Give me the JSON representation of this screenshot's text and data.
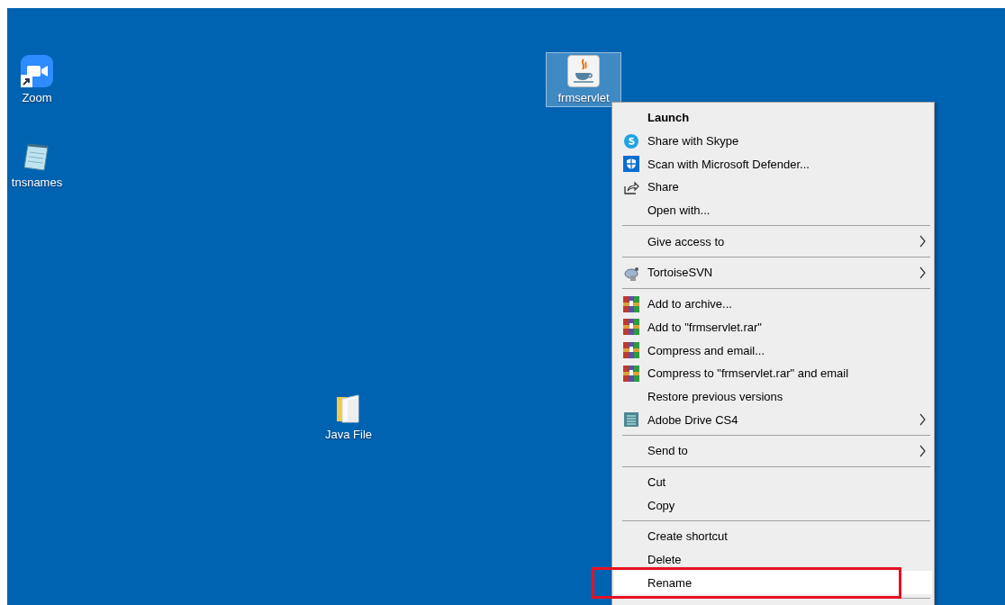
{
  "desktop_icons": [
    {
      "label": "Zoom",
      "kind": "zoom",
      "selected": false
    },
    {
      "label": "tnsnames",
      "kind": "notepad",
      "selected": false
    },
    {
      "label": "frmservlet",
      "kind": "java",
      "selected": true
    },
    {
      "label": "Java File",
      "kind": "folder",
      "selected": false
    }
  ],
  "context_menu": {
    "items": [
      {
        "kind": "item",
        "label": "Launch",
        "default": true,
        "submenu": false,
        "highlighted": false,
        "annotated": false
      },
      {
        "kind": "item",
        "label": "Share with Skype",
        "default": false,
        "submenu": false,
        "highlighted": false,
        "annotated": false
      },
      {
        "kind": "item",
        "label": "Scan with Microsoft Defender...",
        "default": false,
        "submenu": false,
        "highlighted": false,
        "annotated": false
      },
      {
        "kind": "item",
        "label": "Share",
        "default": false,
        "submenu": false,
        "highlighted": false,
        "annotated": false
      },
      {
        "kind": "item",
        "label": "Open with...",
        "default": false,
        "submenu": false,
        "highlighted": false,
        "annotated": false
      },
      {
        "kind": "separator"
      },
      {
        "kind": "item",
        "label": "Give access to",
        "default": false,
        "submenu": true,
        "highlighted": false,
        "annotated": false
      },
      {
        "kind": "separator"
      },
      {
        "kind": "item",
        "label": "TortoiseSVN",
        "default": false,
        "submenu": true,
        "highlighted": false,
        "annotated": false
      },
      {
        "kind": "separator"
      },
      {
        "kind": "item",
        "label": "Add to archive...",
        "default": false,
        "submenu": false,
        "highlighted": false,
        "annotated": false
      },
      {
        "kind": "item",
        "label": "Add to \"frmservlet.rar\"",
        "default": false,
        "submenu": false,
        "highlighted": false,
        "annotated": false
      },
      {
        "kind": "item",
        "label": "Compress and email...",
        "default": false,
        "submenu": false,
        "highlighted": false,
        "annotated": false
      },
      {
        "kind": "item",
        "label": "Compress to \"frmservlet.rar\" and email",
        "default": false,
        "submenu": false,
        "highlighted": false,
        "annotated": false
      },
      {
        "kind": "item",
        "label": "Restore previous versions",
        "default": false,
        "submenu": false,
        "highlighted": false,
        "annotated": false
      },
      {
        "kind": "item",
        "label": "Adobe Drive CS4",
        "default": false,
        "submenu": true,
        "highlighted": false,
        "annotated": false
      },
      {
        "kind": "separator"
      },
      {
        "kind": "item",
        "label": "Send to",
        "default": false,
        "submenu": true,
        "highlighted": false,
        "annotated": false
      },
      {
        "kind": "separator"
      },
      {
        "kind": "item",
        "label": "Cut",
        "default": false,
        "submenu": false,
        "highlighted": false,
        "annotated": false
      },
      {
        "kind": "item",
        "label": "Copy",
        "default": false,
        "submenu": false,
        "highlighted": false,
        "annotated": false
      },
      {
        "kind": "separator"
      },
      {
        "kind": "item",
        "label": "Create shortcut",
        "default": false,
        "submenu": false,
        "highlighted": false,
        "annotated": false
      },
      {
        "kind": "item",
        "label": "Delete",
        "default": false,
        "submenu": false,
        "highlighted": false,
        "annotated": false
      },
      {
        "kind": "item",
        "label": "Rename",
        "default": false,
        "submenu": false,
        "highlighted": true,
        "annotated": true
      },
      {
        "kind": "separator"
      }
    ]
  }
}
